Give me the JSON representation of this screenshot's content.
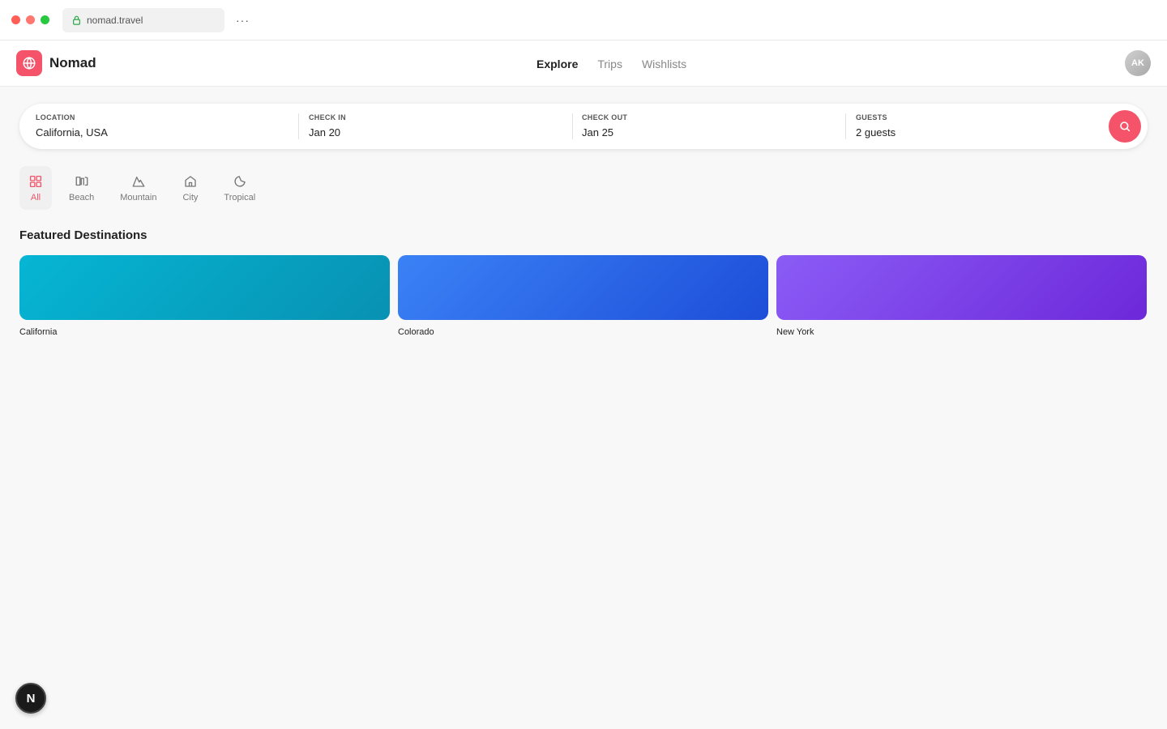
{
  "browser": {
    "url": "nomad.travel",
    "more_label": "···"
  },
  "app": {
    "name": "Nomad",
    "brand_color": "#f4536a",
    "nav": [
      {
        "label": "Explore",
        "active": true
      },
      {
        "label": "Trips",
        "active": false
      },
      {
        "label": "Wishlists",
        "active": false
      }
    ],
    "avatar_initials": "AK"
  },
  "search": {
    "location_label": "LOCATION",
    "location_value": "California, USA",
    "checkin_label": "CHECK IN",
    "checkin_value": "Jan 20",
    "checkout_label": "CHECK OUT",
    "checkout_value": "Jan 25",
    "guests_label": "GUESTS",
    "guests_value": "2 guests",
    "button_icon": "search-icon"
  },
  "categories": [
    {
      "label": "All",
      "icon": "grid-icon",
      "active": true
    },
    {
      "label": "Beach",
      "icon": "beach-icon",
      "active": false
    },
    {
      "label": "Mountain",
      "icon": "mountain-icon",
      "active": false
    },
    {
      "label": "City",
      "icon": "home-icon",
      "active": false
    },
    {
      "label": "Tropical",
      "icon": "tropical-icon",
      "active": false
    }
  ],
  "featured": {
    "title": "Featured Destinations",
    "items": [
      {
        "name": "California",
        "gradient": [
          "#06b6d4",
          "#0891b2"
        ]
      },
      {
        "name": "Colorado",
        "gradient": [
          "#3b82f6",
          "#1d4ed8"
        ]
      },
      {
        "name": "New York",
        "gradient": [
          "#8b5cf6",
          "#6d28d9"
        ]
      }
    ]
  },
  "floating_badge": "N"
}
